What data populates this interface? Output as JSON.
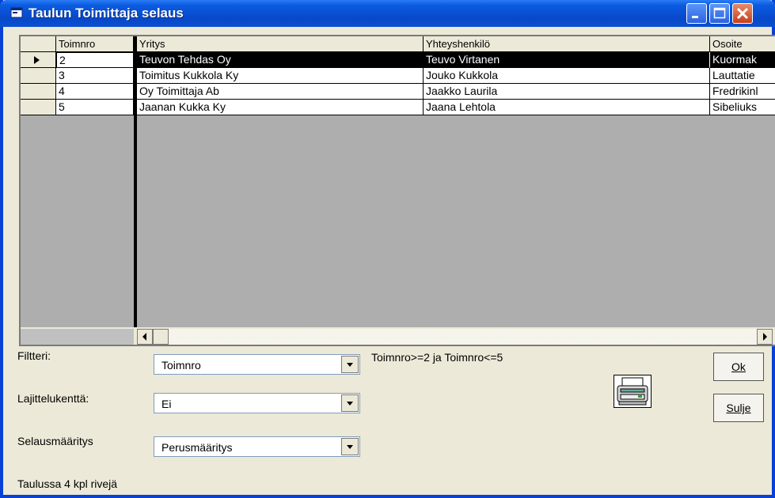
{
  "window": {
    "title": "Taulun Toimittaja selaus"
  },
  "grid": {
    "columns": [
      "Toimnro",
      "Yritys",
      "Yhteyshenkilö",
      "Osoite"
    ],
    "rows": [
      [
        "2",
        "Teuvon Tehdas Oy",
        "Teuvo Virtanen",
        "Kuormak"
      ],
      [
        "3",
        "Toimitus Kukkola Ky",
        "Jouko Kukkola",
        "Lauttatie"
      ],
      [
        "4",
        "Oy Toimittaja Ab",
        "Jaakko Laurila",
        "Fredrikinl"
      ],
      [
        "5",
        "Jaanan Kukka Ky",
        "Jaana Lehtola",
        "Sibeliuks"
      ]
    ],
    "selected_row": 0
  },
  "filter": {
    "label": "Filtteri:",
    "value": "Toimnro",
    "expression": "Toimnro>=2 ja Toimnro<=5"
  },
  "sort": {
    "label": "Lajittelukenttä:",
    "value": "Ei"
  },
  "browse": {
    "label": "Selausmääritys",
    "value": "Perusmääritys"
  },
  "buttons": {
    "ok": "Ok",
    "close": "Sulje"
  },
  "status": "Taulussa 4 kpl rivejä"
}
